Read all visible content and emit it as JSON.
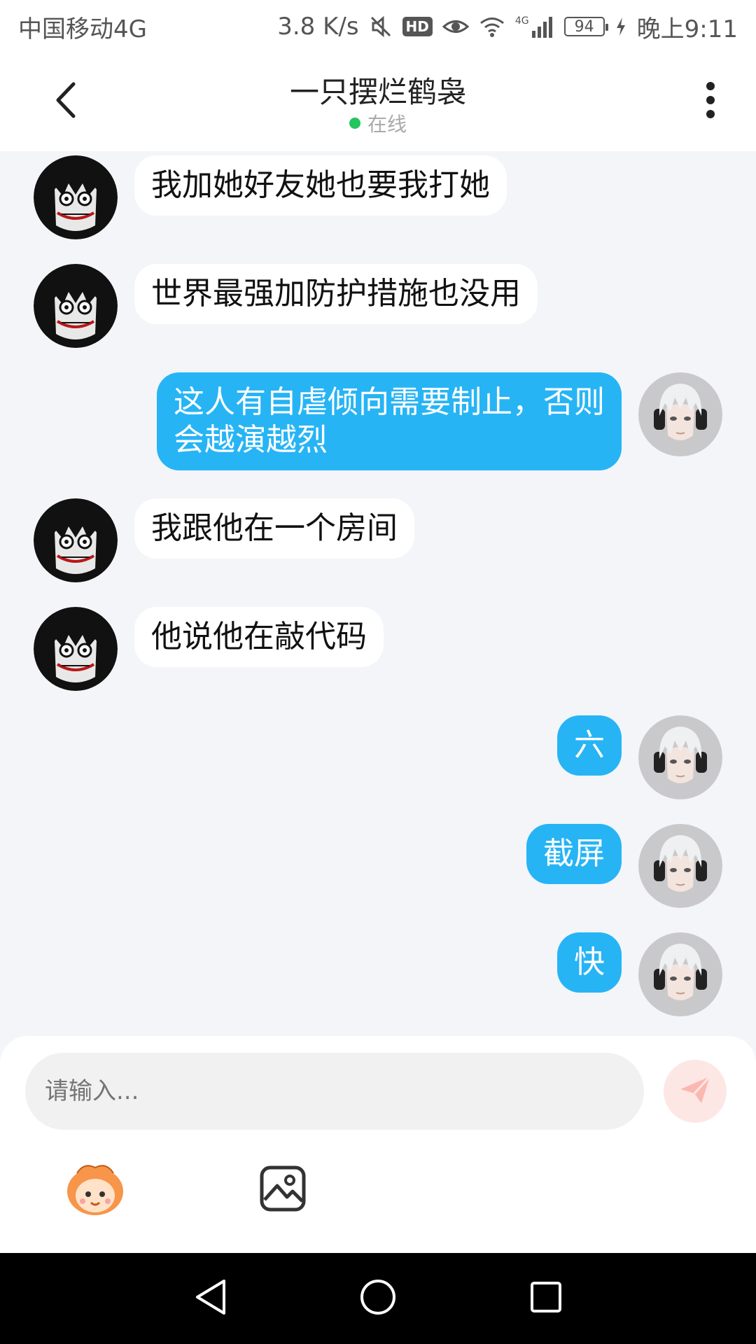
{
  "status_bar": {
    "carrier": "中国移动4G",
    "net_speed": "3.8 K/s",
    "hd_label": "HD",
    "net_type": "4G",
    "battery": "94",
    "time": "晚上9:11",
    "icons": [
      "mute-icon",
      "hd-icon",
      "eye-icon",
      "wifi-icon",
      "signal-icon",
      "battery-icon",
      "charging-icon"
    ]
  },
  "header": {
    "title": "一只摆烂鹤袅",
    "status": "在线",
    "status_color": "#22c55e",
    "back_icon": "chevron-left-icon",
    "more_icon": "more-vertical-icon"
  },
  "messages": [
    {
      "side": "left",
      "text": "我加她好友她也要我打她"
    },
    {
      "side": "left",
      "text": "世界最强加防护措施也没用"
    },
    {
      "side": "right",
      "line1": "这人有自虐倾向需要制止，否则",
      "line2": "会越演越烈"
    },
    {
      "side": "left",
      "text": "我跟他在一个房间"
    },
    {
      "side": "left",
      "text": "他说他在敲代码"
    },
    {
      "side": "right",
      "text": "六"
    },
    {
      "side": "right",
      "text": "截屏"
    },
    {
      "side": "right",
      "text": "快"
    }
  ],
  "input": {
    "placeholder": "请输入...",
    "send_icon": "paper-plane-icon"
  },
  "toolbar": {
    "emoji_icon": "emoji-mascot-icon",
    "image_icon": "image-icon"
  },
  "nav": {
    "icons": [
      "back-triangle-icon",
      "home-circle-icon",
      "recents-square-icon"
    ]
  },
  "colors": {
    "outgoing_bubble": "#27b4f5",
    "incoming_bubble": "#ffffff",
    "chat_background": "#f3f5f8",
    "send_button": "#fde7e5"
  }
}
